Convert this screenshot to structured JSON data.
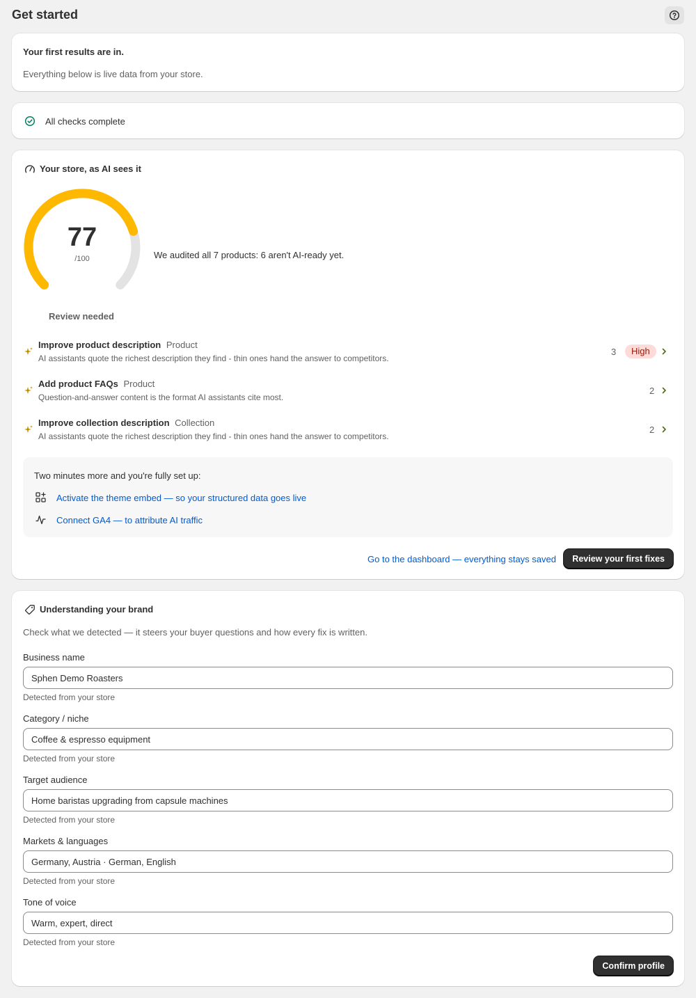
{
  "header": {
    "title": "Get started",
    "help_icon": "question-circle-icon"
  },
  "results": {
    "title": "Your first results are in.",
    "subtitle": "Everything below is live data from your store."
  },
  "checks": {
    "icon": "check-circle-icon",
    "label": "All checks complete",
    "color": "#007f5f"
  },
  "ai_view": {
    "icon": "gauge-icon",
    "title": "Your store, as AI sees it",
    "score": "77",
    "score_max": "/100",
    "score_fraction": 0.77,
    "gauge_color": "#ffb800",
    "status": "Review needed",
    "summary": "We audited all 7 products: 6 aren't AI-ready yet.",
    "recommendations": [
      {
        "title": "Improve product description",
        "type": "Product",
        "description": "AI assistants quote the richest description they find - thin ones hand the answer to competitors.",
        "count": "3",
        "badge": "High"
      },
      {
        "title": "Add product FAQs",
        "type": "Product",
        "description": "Question-and-answer content is the format AI assistants cite most.",
        "count": "2"
      },
      {
        "title": "Improve collection description",
        "type": "Collection",
        "description": "AI assistants quote the richest description they find - thin ones hand the answer to competitors.",
        "count": "2"
      }
    ],
    "setup": {
      "heading": "Two minutes more and you're fully set up:",
      "items": [
        {
          "icon": "apps-icon",
          "label": "Activate the theme embed — so your structured data goes live"
        },
        {
          "icon": "pulse-icon",
          "label": "Connect GA4 — to attribute AI traffic"
        }
      ]
    },
    "dashboard_link": "Go to the dashboard — everything stays saved",
    "primary_button": "Review your first fixes"
  },
  "brand": {
    "icon": "tag-icon",
    "title": "Understanding your brand",
    "subtitle": "Check what we detected — it steers your buyer questions and how every fix is written.",
    "fields": [
      {
        "label": "Business name",
        "value": "Sphen Demo Roasters",
        "help": "Detected from your store"
      },
      {
        "label": "Category / niche",
        "value": "Coffee & espresso equipment",
        "help": "Detected from your store"
      },
      {
        "label": "Target audience",
        "value": "Home baristas upgrading from capsule machines",
        "help": "Detected from your store"
      },
      {
        "label": "Markets & languages",
        "value": "Germany, Austria · German, English",
        "help": "Detected from your store"
      },
      {
        "label": "Tone of voice",
        "value": "Warm, expert, direct",
        "help": "Detected from your store"
      }
    ],
    "confirm_button": "Confirm profile"
  }
}
